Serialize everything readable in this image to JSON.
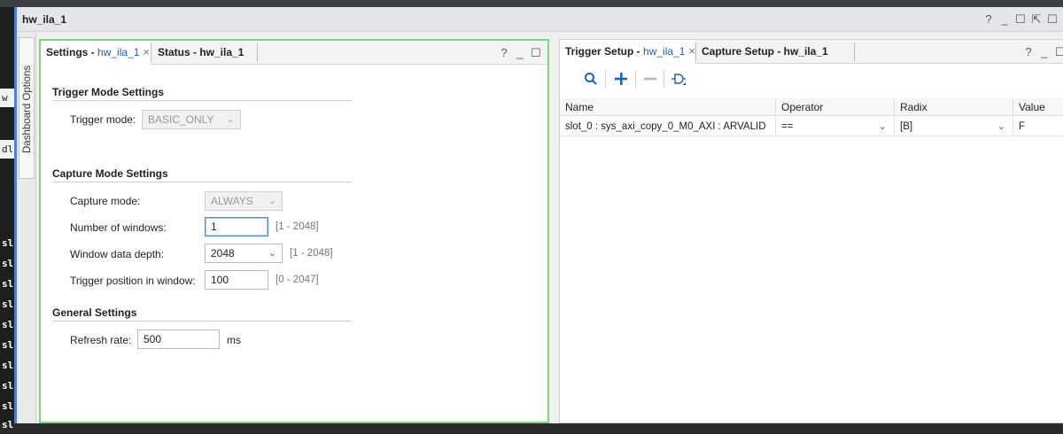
{
  "background_cells": [
    "w",
    "",
    "dle",
    "",
    "",
    "",
    "sl",
    "sl",
    "sl",
    "sl",
    "sl",
    "sl",
    "sl",
    "sl",
    "sl",
    "sl"
  ],
  "window": {
    "title": "hw_ila_1",
    "controls": [
      "?",
      "_",
      "☐",
      "⇱",
      "☐"
    ]
  },
  "side_strip": {
    "label": "Dashboard Options"
  },
  "left_panel": {
    "tabs": [
      {
        "prefix": "Settings - ",
        "name": "hw_ila_1",
        "close": "×"
      },
      {
        "prefix": "Status - hw_ila_1",
        "name": "",
        "close": ""
      }
    ],
    "controls": [
      "?",
      "_",
      "☐"
    ],
    "trigger_mode": {
      "heading": "Trigger Mode Settings",
      "label": "Trigger mode:",
      "value": "BASIC_ONLY"
    },
    "capture_mode": {
      "heading": "Capture Mode Settings",
      "capture_label": "Capture mode:",
      "capture_value": "ALWAYS",
      "windows_label": "Number of windows:",
      "windows_value": "1",
      "windows_range": "[1 - 2048]",
      "depth_label": "Window data depth:",
      "depth_value": "2048",
      "depth_range": "[1 - 2048]",
      "trigpos_label": "Trigger position in window:",
      "trigpos_value": "100",
      "trigpos_range": "[0 - 2047]"
    },
    "general": {
      "heading": "General Settings",
      "refresh_label": "Refresh rate:",
      "refresh_value": "500",
      "refresh_unit": "ms"
    }
  },
  "right_panel": {
    "tabs": [
      {
        "prefix": "Trigger Setup - ",
        "name": "hw_ila_1",
        "close": "×"
      },
      {
        "prefix": "Capture Setup - hw_ila_1",
        "name": "",
        "close": ""
      }
    ],
    "controls": [
      "?",
      "_",
      "☐"
    ],
    "toolbar": {
      "search_icon": "search-icon",
      "add_icon": "plus-icon",
      "remove_icon": "minus-icon",
      "gate_icon": "logic-gate-icon"
    },
    "table": {
      "columns": [
        "Name",
        "Operator",
        "Radix",
        "Value"
      ],
      "rows": [
        {
          "name": "slot_0 : sys_axi_copy_0_M0_AXI : ARVALID",
          "operator": "==",
          "radix": "[B]",
          "value": "F"
        }
      ]
    }
  },
  "colors": {
    "accent_blue": "#1f5fbf",
    "focus_border_green": "#7ed67e",
    "window_border": "#4a7fd4"
  }
}
